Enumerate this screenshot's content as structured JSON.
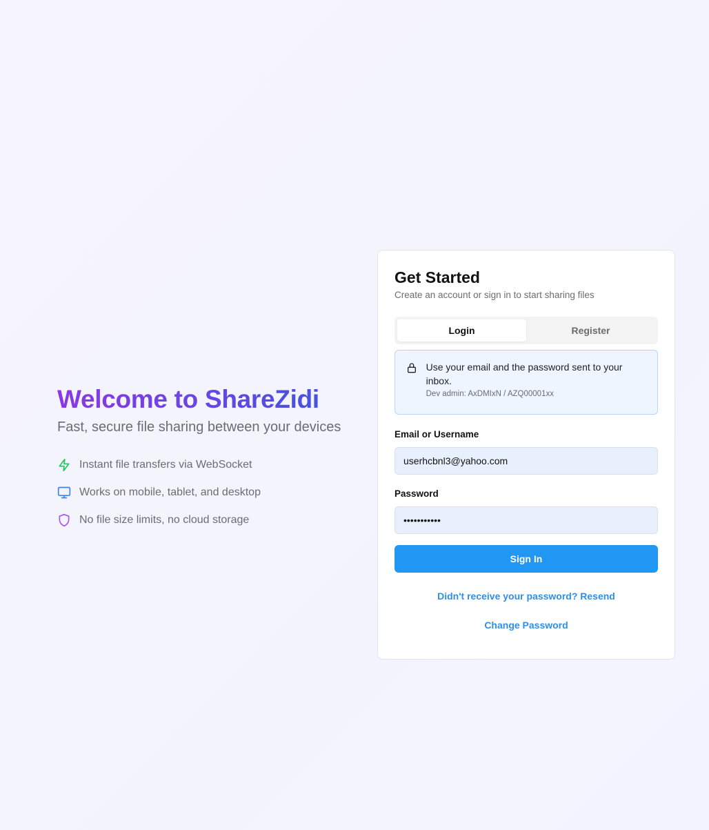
{
  "hero": {
    "title": "Welcome to ShareZidi",
    "subtitle": "Fast, secure file sharing between your devices",
    "features": [
      {
        "icon": "lightning-icon",
        "color": "#22c55e",
        "text": "Instant file transfers via WebSocket"
      },
      {
        "icon": "monitor-icon",
        "color": "#3b82f6",
        "text": "Works on mobile, tablet, and desktop"
      },
      {
        "icon": "shield-icon",
        "color": "#a855f7",
        "text": "No file size limits, no cloud storage"
      }
    ]
  },
  "card": {
    "title": "Get Started",
    "subtitle": "Create an account or sign in to start sharing files",
    "tabs": [
      {
        "label": "Login",
        "active": true
      },
      {
        "label": "Register",
        "active": false
      }
    ],
    "notice": {
      "icon": "lock-icon",
      "text": "Use your email and the password sent to your inbox.",
      "dev": "Dev admin: AxDMIxN / AZQ00001xx"
    },
    "email": {
      "label": "Email or Username",
      "value": "userhcbnl3@yahoo.com"
    },
    "password": {
      "label": "Password",
      "value": "•••••••••••"
    },
    "signin_label": "Sign In",
    "resend_label": "Didn't receive your password? Resend",
    "change_label": "Change Password"
  },
  "colors": {
    "primary": "#2196f3",
    "link": "#2f8ee6",
    "gradient_start": "#8a38e6",
    "gradient_end": "#3a56de"
  }
}
